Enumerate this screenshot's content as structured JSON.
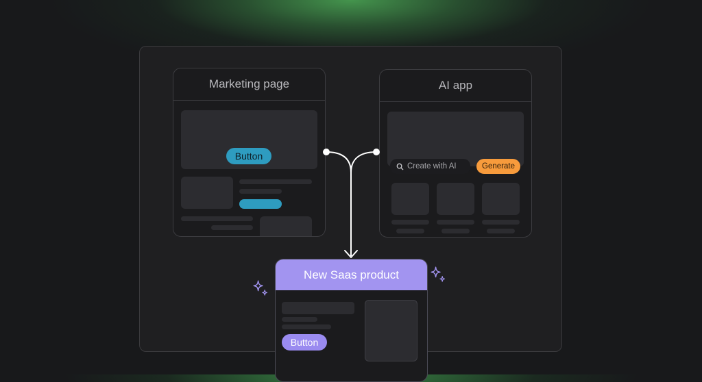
{
  "marketing": {
    "title": "Marketing page",
    "button_label": "Button"
  },
  "ai_app": {
    "title": "AI app",
    "search_placeholder": "Create with AI",
    "generate_label": "Generate"
  },
  "new_product": {
    "title": "New Saas product",
    "button_label": "Button"
  },
  "icons": {
    "search": "search-icon",
    "sparkle": "sparkle-icon",
    "arrow": "arrow-down-icon"
  },
  "colors": {
    "accent_blue": "#2e9cc0",
    "accent_orange": "#f79b3c",
    "accent_purple": "#a294f0",
    "glow_green": "#3f8a48",
    "background": "#18191b"
  }
}
